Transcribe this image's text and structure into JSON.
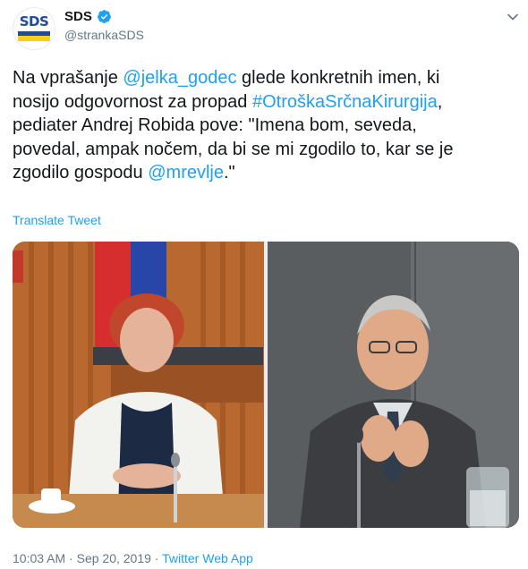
{
  "account": {
    "display_name": "SDS",
    "handle": "@strankaSDS",
    "avatar_logo_text": "SDS"
  },
  "tweet": {
    "segments": [
      {
        "text": "Na vprašanje ",
        "link": false
      },
      {
        "text": "@jelka_godec",
        "link": true
      },
      {
        "text": " glede konkretnih imen, ki\nnosijo odgovornost za propad ",
        "link": false
      },
      {
        "text": "#OtroškaSrčnaKirurgija",
        "link": true
      },
      {
        "text": ",\npediater Andrej Robida pove: \"Imena bom, seveda,\npovedal, ampak nočem, da bi se mi zgodilo to, kar se je\nzgodilo gospodu ",
        "link": false
      },
      {
        "text": "@mrevlje",
        "link": true
      },
      {
        "text": ".\"",
        "link": false
      }
    ],
    "translate_label": "Translate Tweet"
  },
  "media": {
    "left_photo_icon": "photo-woman-at-hearing",
    "right_photo_icon": "photo-man-at-hearing"
  },
  "footer": {
    "time": "10:03 AM",
    "separator": "·",
    "date": "Sep 20, 2019",
    "app": "Twitter Web App"
  },
  "colors": {
    "link": "#1da1f2",
    "text": "#14171a",
    "muted": "#657786",
    "brand_blue": "#1f4aa0",
    "brand_yellow": "#f7d117"
  }
}
